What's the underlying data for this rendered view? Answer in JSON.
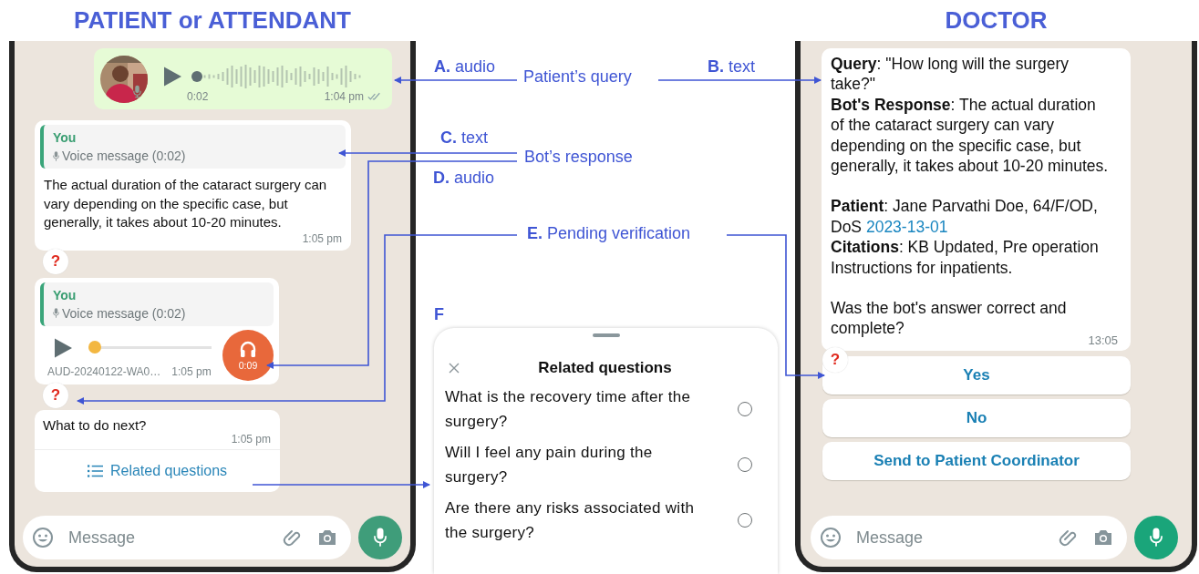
{
  "headings": [
    {
      "text": "PATIENT or ATTENDANT"
    },
    {
      "text": "DOCTOR"
    }
  ],
  "patient_chat": {
    "voice_note": {
      "duration": "0:02",
      "time": "1:04 pm"
    },
    "text_reply": {
      "quote_author": "You",
      "quote_text": "Voice message (0:02)",
      "text": "The actual duration of the cataract surgery can vary depending on the specific case, but generally, it takes about 10-20 minutes.",
      "time": "1:05 pm",
      "pending_mark": "?"
    },
    "audio_reply": {
      "quote_author": "You",
      "quote_text": "Voice message (0:02)",
      "filename": "AUD-20240122-WA0…",
      "time": "1:05 pm",
      "badge": "0:09",
      "level": 0,
      "pending_mark": "?"
    },
    "next_message": {
      "text": "What to do next?",
      "time": "1:05 pm",
      "action": "Related questions"
    },
    "composer": {
      "placeholder": "Message"
    }
  },
  "annotations": [
    {
      "text": "**A.** audio"
    },
    {
      "text": "Patient’s query"
    },
    {
      "text": "**B.** text"
    },
    {
      "text": "**C.** text"
    },
    {
      "text": "Bot’s response"
    },
    {
      "text": "**D.** audio"
    },
    {
      "text": "**E.** Pending verification"
    }
  ],
  "related_sheet": {
    "letter": "F",
    "title": "Related questions",
    "options": [
      {
        "text": "What is the recovery time after the surgery?",
        "selected": false
      },
      {
        "text": "Will I feel any pain during the surgery?",
        "selected": false
      },
      {
        "text": "Are there any risks associated with the surgery?",
        "selected": false
      }
    ]
  },
  "doctor_chat": {
    "message": {
      "blocks": [
        [
          {
            "text": "**Query**: \"How long will the surgery take?\""
          },
          {
            "text": "**Bot's Response**: The actual duration of the cataract surgery can vary depending on the specific case, but generally, it takes about 10-20 minutes."
          }
        ],
        [
          {
            "text": "**Patient**: Jane Parvathi Doe, 64/F/OD, DoS",
            "link": "2023-13-01"
          },
          {
            "text": "**Citations**: KB Updated, Pre operation Instructions for inpatients."
          }
        ],
        [
          {
            "text": "Was the bot's answer correct and complete?"
          }
        ]
      ],
      "time": "13:05",
      "pending_mark": "?"
    },
    "buttons": [
      {
        "label": "Yes"
      },
      {
        "label": "No"
      },
      {
        "label": "Send to Patient Coordinator"
      }
    ],
    "composer": {
      "placeholder": "Message"
    }
  }
}
